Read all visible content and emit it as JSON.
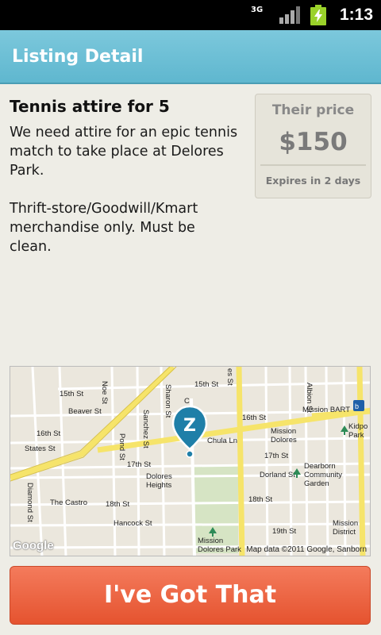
{
  "status_bar": {
    "network": "3G",
    "time": "1:13",
    "icons": [
      "network-3g-icon",
      "signal-icon",
      "battery-charging-icon"
    ]
  },
  "header": {
    "title": "Listing Detail"
  },
  "listing": {
    "title": "Tennis attire for 5",
    "description": "We need attire for an epic tennis match to take place at Delores Park.\n\nThrift-store/Goodwill/Kmart merchandise only. Must be clean."
  },
  "price_box": {
    "label": "Their price",
    "value": "$150",
    "expires": "Expires in 2 days"
  },
  "map": {
    "labels": {
      "st15_left": "15th St",
      "st15_right": "15th St",
      "beaver": "Beaver St",
      "st16_left": "16th St",
      "st16_right": "16th St",
      "states": "States St",
      "st17": "17th St",
      "st17_right": "17th St",
      "dorland": "Dorland St",
      "st18": "18th St",
      "st18_right": "18th St",
      "hancock": "Hancock St",
      "st19": "19th St",
      "castro": "The Castro",
      "dolores_heights": "Dolores Heights",
      "mission_dolores": "Mission Dolores",
      "mission_bart": "Mission BART",
      "dearborn": "Dearborn Community Garden",
      "mission_district": "Mission District",
      "kidpower": "Kidpo Park",
      "mission_dolores_park": "Mission Dolores Park",
      "chula": "Chula Ln",
      "noe": "Noe St",
      "sanchez": "Sanchez St",
      "sharon": "Sharon St",
      "pond": "Pond St",
      "diamond": "Diamond St",
      "albion": "Albion St",
      "ves": "es St",
      "c": "C"
    },
    "attribution": "Map data ©2011 Google, Sanborn",
    "logo": "Google",
    "pin_letter": "Z"
  },
  "cta": {
    "label": "I've Got That"
  },
  "colors": {
    "header": "#67bcd3",
    "cta": "#e85d3a",
    "pin": "#1f7fa8"
  }
}
